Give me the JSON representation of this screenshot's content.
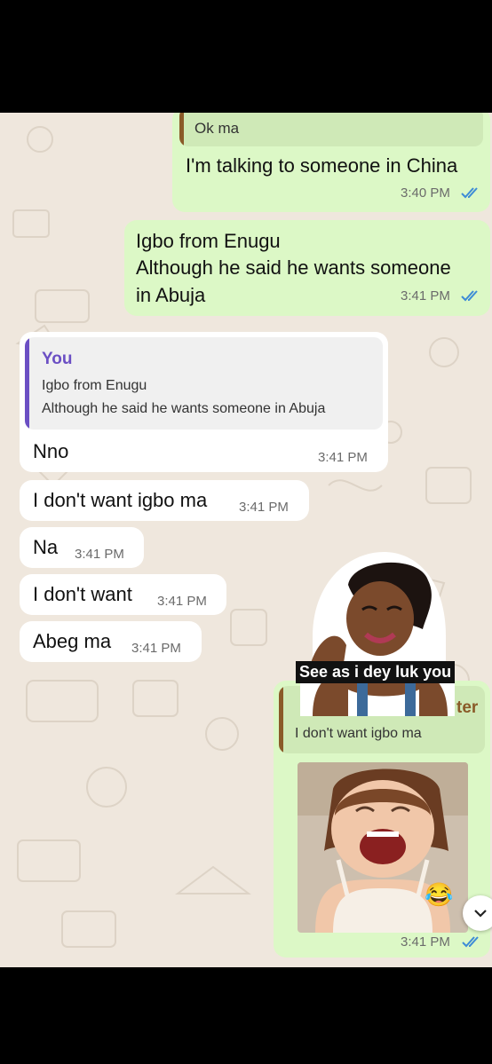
{
  "colors": {
    "outgoing_bubble": "#dcf8c6",
    "incoming_bubble": "#ffffff",
    "chat_background": "#efe7dd",
    "read_ticks": "#3d8bd6",
    "reply_bar_you": "#6b4fc4",
    "reply_bar_other": "#8a5a28"
  },
  "messages": [
    {
      "dir": "out",
      "quote_text": "Ok ma",
      "text": "I'm talking to someone in China",
      "time": "3:40 PM",
      "status": "read"
    },
    {
      "dir": "out",
      "lines": [
        "Igbo from Enugu",
        "Although he said he wants someone",
        "in Abuja"
      ],
      "time": "3:41 PM",
      "status": "read"
    },
    {
      "dir": "in",
      "quote_name": "You",
      "quote_lines": [
        "Igbo from Enugu",
        "Although he said he wants someone in Abuja"
      ],
      "text": "Nno",
      "time": "3:41 PM"
    },
    {
      "dir": "in",
      "text": "I don't want igbo ma",
      "time": "3:41 PM"
    },
    {
      "dir": "in",
      "text": "Na",
      "time": "3:41 PM"
    },
    {
      "dir": "in",
      "text": "I don't want",
      "time": "3:41 PM"
    },
    {
      "dir": "in",
      "text": "Abeg ma",
      "time": "3:41 PM"
    },
    {
      "dir": "out",
      "sticker_caption": "See as i dey luk you",
      "quote_name_partial": "ter",
      "quote_text": "I don't want igbo ma",
      "image": "laughing-baby-photo",
      "emoji": "😂",
      "time": "3:41 PM",
      "status": "read"
    }
  ],
  "scroll_button_icon": "chevron-down-icon"
}
